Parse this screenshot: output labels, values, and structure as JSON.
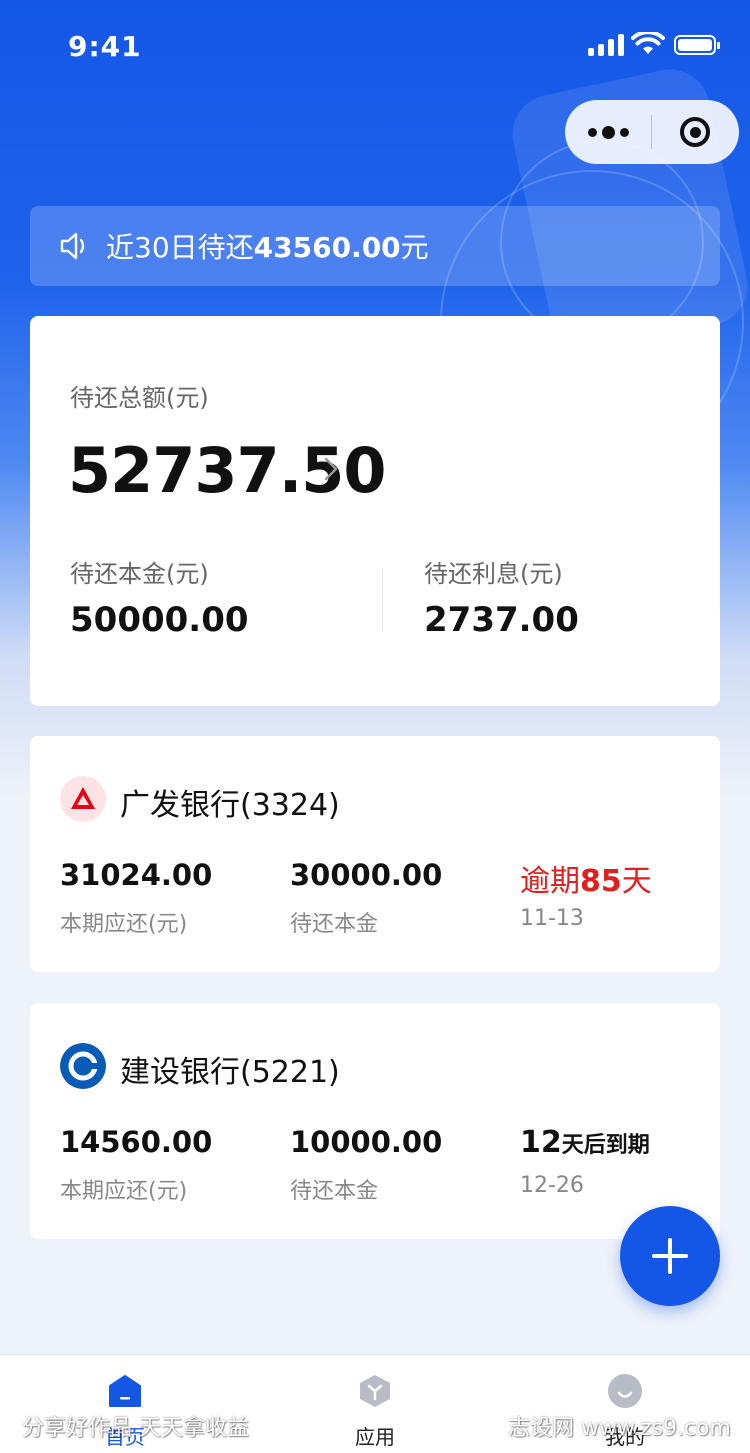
{
  "status_bar": {
    "time": "9:41"
  },
  "notice": {
    "prefix": "近30日待还",
    "amount": "43560.00",
    "suffix": "元"
  },
  "summary": {
    "total_label": "待还总额(元)",
    "total_value": "52737.50",
    "principal_label": "待还本金(元)",
    "principal_value": "50000.00",
    "interest_label": "待还利息(元)",
    "interest_value": "2737.00"
  },
  "loans": [
    {
      "bank": "广发银行(3324)",
      "due_amount": "31024.00",
      "due_amount_label": "本期应还(元)",
      "principal": "30000.00",
      "principal_label": "待还本金",
      "status_prefix": "逾期",
      "status_days": "85",
      "status_suffix": "天",
      "date": "11-13"
    },
    {
      "bank": "建设银行(5221)",
      "due_amount": "14560.00",
      "due_amount_label": "本期应还(元)",
      "principal": "10000.00",
      "principal_label": "待还本金",
      "status_days": "12",
      "status_suffix": "天后到期",
      "date": "12-26"
    }
  ],
  "tabs": [
    {
      "label": "首页",
      "icon": "home-icon",
      "active": true
    },
    {
      "label": "应用",
      "icon": "apps-icon",
      "active": false
    },
    {
      "label": "我的",
      "icon": "profile-icon",
      "active": false
    }
  ],
  "watermarks": {
    "left": "分享好作品 天天拿收益",
    "right": "志设网 www.zs9.com"
  },
  "colors": {
    "brand": "#1457e6",
    "overdue": "#e0201e",
    "gf_bank": "#e60012",
    "ccb_bank": "#0a5bb5"
  }
}
